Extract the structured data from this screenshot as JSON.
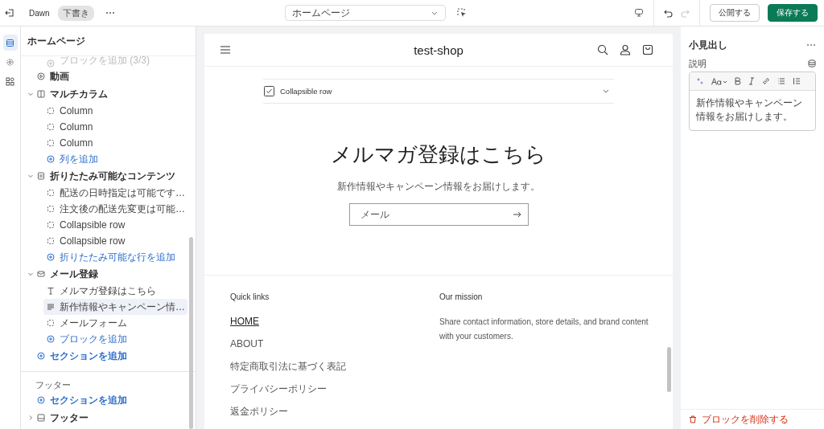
{
  "topbar": {
    "theme": "Dawn",
    "badge": "下書き",
    "page_select": {
      "value": "ホームページ"
    },
    "undo": {
      "disabled": false
    },
    "redo": {
      "disabled": true
    },
    "buttons": [
      {
        "label": "公開する",
        "kind": "secondary"
      },
      {
        "label": "保存する",
        "kind": "primary"
      }
    ]
  },
  "rail": {
    "items": [
      {
        "kind": "sections",
        "selected": true
      },
      {
        "kind": "settings",
        "selected": false
      },
      {
        "kind": "apps",
        "selected": false
      }
    ]
  },
  "sidebar": {
    "title": "ホームページ",
    "items": [
      {
        "kind": "add-block",
        "label": "ブロックを追加 (3/3)",
        "disabled": true
      },
      {
        "kind": "video",
        "label": "動画"
      },
      {
        "kind": "columns",
        "label": "マルチカラム",
        "expanded": true,
        "children": [
          {
            "kind": "block",
            "label": "Column",
            "selected": false
          },
          {
            "kind": "block",
            "label": "Column",
            "selected": false
          },
          {
            "kind": "block",
            "label": "Column",
            "selected": false
          },
          {
            "kind": "add",
            "label": "列を追加",
            "disabled": false
          }
        ]
      },
      {
        "kind": "collapsible",
        "label": "折りたたみ可能なコンテンツ",
        "expanded": true,
        "children": [
          {
            "kind": "block",
            "label": "配送の日時指定は可能です…",
            "selected": false
          },
          {
            "kind": "block",
            "label": "注文後の配送先変更は可能…",
            "selected": false
          },
          {
            "kind": "block",
            "label": "Collapsible row",
            "selected": false
          },
          {
            "kind": "block",
            "label": "Collapsible row",
            "selected": false
          },
          {
            "kind": "add",
            "label": "折りたたみ可能な行を追加",
            "disabled": false
          }
        ]
      },
      {
        "kind": "newsletter",
        "label": "メール登録",
        "expanded": true,
        "children": [
          {
            "kind": "text",
            "label": "メルマガ登録はこちら",
            "selected": false
          },
          {
            "kind": "paragraph",
            "label": "新作情報やキャンペーン情…",
            "selected": true
          },
          {
            "kind": "block",
            "label": "メールフォーム",
            "selected": false
          },
          {
            "kind": "add",
            "label": "ブロックを追加",
            "disabled": false
          }
        ]
      },
      {
        "kind": "add-section",
        "label": "セクションを追加"
      }
    ],
    "footer_group": {
      "label": "フッター",
      "items": [
        {
          "kind": "add-section",
          "label": "セクションを追加"
        },
        {
          "kind": "footer",
          "label": "フッター",
          "expanded": false
        }
      ]
    }
  },
  "preview": {
    "store_name": "test-shop",
    "rows": [
      {
        "label": "Collapsible row"
      }
    ],
    "newsletter": {
      "heading": "メルマガ登録はこちら",
      "text": "新作情報やキャンペーン情報をお届けします。",
      "email": {
        "placeholder": "メール"
      }
    },
    "footer": {
      "links_heading": "Quick links",
      "links": [
        {
          "label": "HOME",
          "selected": true
        },
        {
          "label": "ABOUT",
          "selected": false
        },
        {
          "label": "特定商取引法に基づく表記",
          "selected": false
        },
        {
          "label": "プライバシーポリシー",
          "selected": false
        },
        {
          "label": "返金ポリシー",
          "selected": false
        }
      ],
      "mission_heading": "Our mission",
      "mission_text": "Share contact information, store details, and brand content with your customers."
    }
  },
  "inspector": {
    "title": "小見出し",
    "field_label": "説明",
    "editor_text": "新作情報やキャンペーン情報をお届けします。",
    "delete": "ブロックを削除する"
  }
}
